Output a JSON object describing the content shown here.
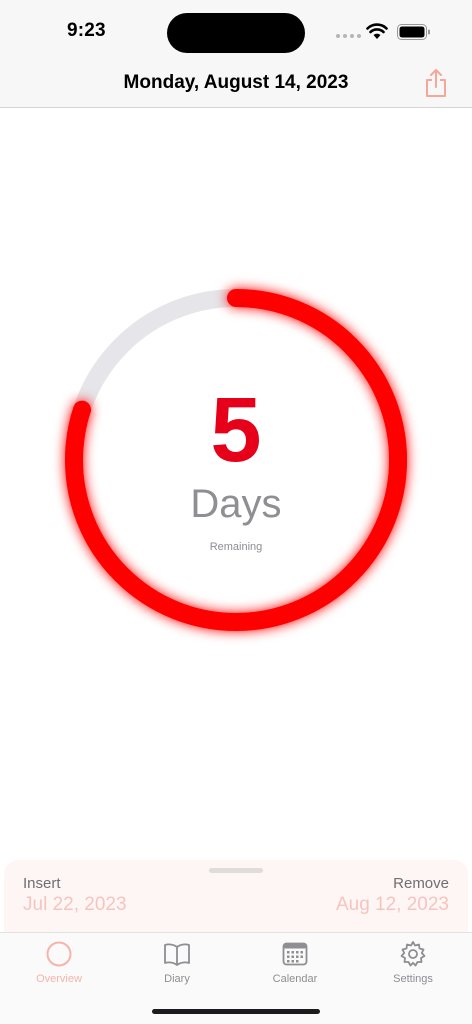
{
  "status_bar": {
    "time": "9:23"
  },
  "header": {
    "title": "Monday, August 14, 2023",
    "share_icon": "share-icon"
  },
  "countdown": {
    "number": "5",
    "unit": "Days",
    "caption": "Remaining",
    "progress_fraction": 0.8,
    "progress_color": "#ff0000",
    "track_color": "#e5e5ea"
  },
  "sheet": {
    "insert_label": "Insert",
    "insert_date": "Jul 22, 2023",
    "remove_label": "Remove",
    "remove_date": "Aug 12, 2023"
  },
  "tabs": [
    {
      "label": "Overview",
      "icon": "circle-icon",
      "active": true
    },
    {
      "label": "Diary",
      "icon": "book-icon",
      "active": false
    },
    {
      "label": "Calendar",
      "icon": "calendar-icon",
      "active": false
    },
    {
      "label": "Settings",
      "icon": "gear-icon",
      "active": false
    }
  ],
  "colors": {
    "accent": "#f6b3aa",
    "ring_red": "#ff0000",
    "number_red": "#e6001a"
  }
}
